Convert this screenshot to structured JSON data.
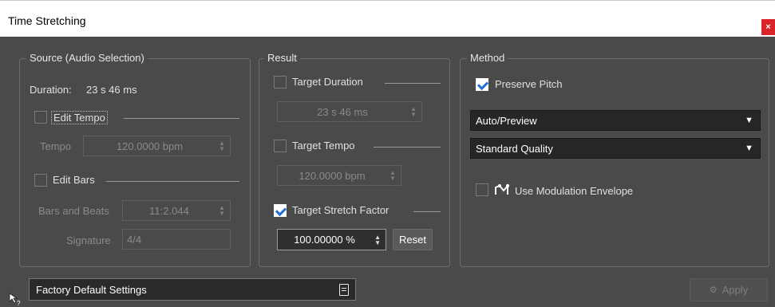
{
  "window": {
    "title": "Time Stretching",
    "close_glyph": "×"
  },
  "source": {
    "legend": "Source (Audio Selection)",
    "duration_label": "Duration:",
    "duration_value": "23 s 46 ms",
    "edit_tempo": {
      "label": "Edit Tempo",
      "checked": false
    },
    "tempo": {
      "label": "Tempo",
      "value": "120.0000 bpm"
    },
    "edit_bars": {
      "label": "Edit Bars",
      "checked": false
    },
    "bars_and_beats": {
      "label": "Bars and Beats",
      "value": "11:2.044"
    },
    "signature": {
      "label": "Signature",
      "value": "4/4"
    }
  },
  "result": {
    "legend": "Result",
    "target_duration": {
      "label": "Target Duration",
      "checked": false,
      "value": "23 s 46 ms"
    },
    "target_tempo": {
      "label": "Target Tempo",
      "checked": false,
      "value": "120.0000 bpm"
    },
    "target_stretch": {
      "label": "Target Stretch Factor",
      "checked": true,
      "value": "100.00000 %"
    },
    "reset_label": "Reset"
  },
  "method": {
    "legend": "Method",
    "preserve_pitch": {
      "label": "Preserve Pitch",
      "checked": true
    },
    "mode_select": "Auto/Preview",
    "quality_select": "Standard Quality",
    "modulation": {
      "label": "Use Modulation Envelope",
      "checked": false
    }
  },
  "footer": {
    "preset": "Factory Default Settings",
    "apply_label": "Apply"
  },
  "colors": {
    "accent": "#1f6fd0",
    "close": "#d8232a",
    "panel": "#4a4a4a"
  }
}
